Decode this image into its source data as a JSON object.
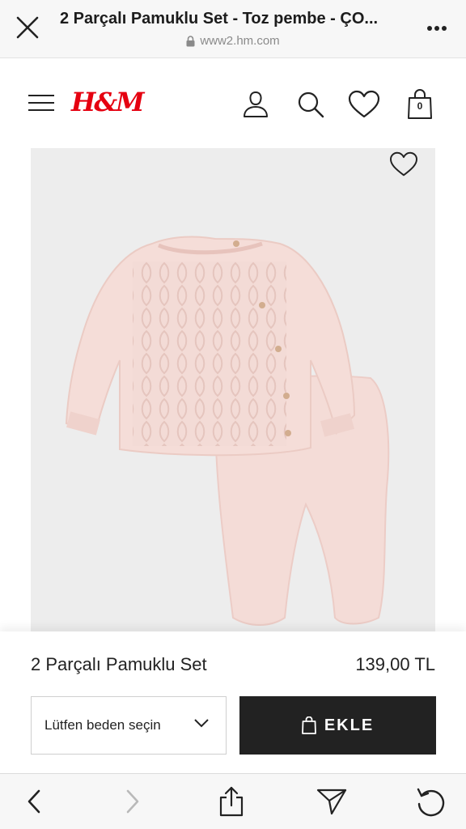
{
  "browser": {
    "tab_title": "2 Parçalı Pamuklu Set - Toz pembe - ÇO...",
    "url": "www2.hm.com"
  },
  "header": {
    "logo_text": "H&M",
    "cart_count": "0",
    "brand_color": "#e50010"
  },
  "product": {
    "name": "2 Parçalı Pamuklu Set",
    "price": "139,00 TL",
    "color_name": "Toz pembe",
    "swatch_color": "#f2d6d0"
  },
  "actions": {
    "size_placeholder": "Lütfen beden seçin",
    "add_label": "EKLE"
  },
  "icons": {
    "close": "close-icon",
    "lock": "lock-icon",
    "more": "more-icon",
    "menu": "menu-icon",
    "account": "account-icon",
    "search": "search-icon",
    "favorites": "heart-icon",
    "cart": "shopping-bag-icon",
    "chevron": "chevron-down-icon",
    "back": "back-icon",
    "forward": "forward-icon",
    "share": "share-icon",
    "send": "send-icon",
    "reload": "reload-icon"
  }
}
